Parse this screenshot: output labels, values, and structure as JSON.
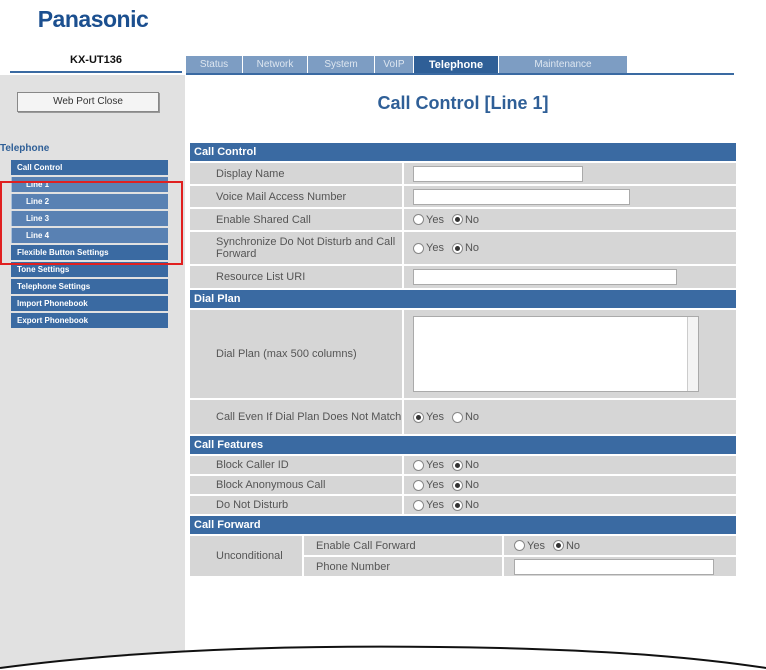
{
  "brand": {
    "logo": "Panasonic",
    "model": "KX-UT136"
  },
  "tabs": [
    {
      "label": "Status",
      "active": false
    },
    {
      "label": "Network",
      "active": false
    },
    {
      "label": "System",
      "active": false
    },
    {
      "label": "VoIP",
      "active": false
    },
    {
      "label": "Telephone",
      "active": true
    },
    {
      "label": "Maintenance",
      "active": false
    }
  ],
  "sidebar": {
    "logout_label": "Web Port Close",
    "heading": "Telephone",
    "items": [
      {
        "label": "Call Control",
        "sub": false
      },
      {
        "label": "Line 1",
        "sub": true
      },
      {
        "label": "Line 2",
        "sub": true
      },
      {
        "label": "Line 3",
        "sub": true
      },
      {
        "label": "Line 4",
        "sub": true
      },
      {
        "label": "Flexible Button Settings",
        "sub": false
      },
      {
        "label": "Tone Settings",
        "sub": false
      },
      {
        "label": "Telephone Settings",
        "sub": false
      },
      {
        "label": "Import Phonebook",
        "sub": false
      },
      {
        "label": "Export Phonebook",
        "sub": false
      }
    ]
  },
  "page_title": "Call Control [Line 1]",
  "radio": {
    "yes": "Yes",
    "no": "No"
  },
  "sections": {
    "call_control": {
      "title": "Call Control",
      "display_name": "Display Name",
      "voice_mail": "Voice Mail Access Number",
      "shared_call": {
        "label": "Enable Shared Call",
        "value": "No"
      },
      "sync_dnd": {
        "label": "Synchronize Do Not Disturb and Call Forward",
        "value": "No"
      },
      "resource_uri": "Resource List URI"
    },
    "dial_plan": {
      "title": "Dial Plan",
      "dial_plan_label": "Dial Plan (max 500 columns)",
      "call_even": {
        "label": "Call Even If Dial Plan Does Not Match",
        "value": "Yes"
      }
    },
    "call_features": {
      "title": "Call Features",
      "block_caller_id": {
        "label": "Block Caller ID",
        "value": "No"
      },
      "block_anonymous": {
        "label": "Block Anonymous Call",
        "value": "No"
      },
      "dnd": {
        "label": "Do Not Disturb",
        "value": "No"
      }
    },
    "call_forward": {
      "title": "Call Forward",
      "unconditional": "Unconditional",
      "enable_cf": {
        "label": "Enable Call Forward",
        "value": "No"
      },
      "phone_number": "Phone Number"
    }
  }
}
